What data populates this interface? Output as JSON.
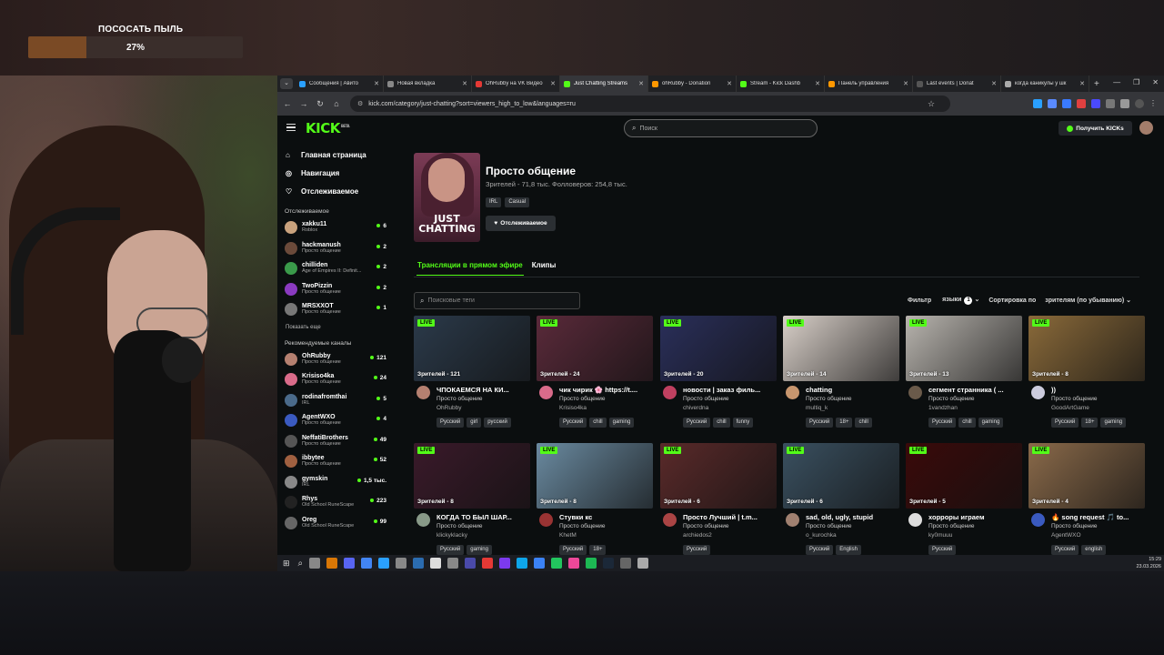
{
  "overlay": {
    "goal_title": "ПОСОСАТЬ ПЫЛЬ",
    "goal_percent": "27%",
    "goal_progress": 0.27
  },
  "browser": {
    "tabs": [
      {
        "label": "Сообщения | Авито",
        "color": "#2aa0ff"
      },
      {
        "label": "Новая вкладка",
        "color": "#888888"
      },
      {
        "label": "OhRubby на VK Видео",
        "color": "#e53935"
      },
      {
        "label": "Just Chatting Streams",
        "color": "#53fc18",
        "active": true
      },
      {
        "label": "ohRubby - Donation",
        "color": "#ff9800"
      },
      {
        "label": "Stream - Kick Dashb",
        "color": "#53fc18"
      },
      {
        "label": "Панель управления",
        "color": "#ff9800"
      },
      {
        "label": "Last events | Donat",
        "color": "#555555"
      },
      {
        "label": "когда каникулы у шк",
        "color": "#aaaaaa"
      }
    ],
    "url": "kick.com/category/just-chatting?sort=viewers_high_to_low&languages=ru"
  },
  "kick": {
    "logo": "KICK",
    "logo_sup": "BETA",
    "search_placeholder": "Поиск",
    "get_kicks": "Получить KICKs",
    "nav": [
      {
        "label": "Главная страница",
        "icon": "home-icon",
        "glyph": "⌂"
      },
      {
        "label": "Навигация",
        "icon": "compass-icon",
        "glyph": "◎"
      },
      {
        "label": "Отслеживаемое",
        "icon": "heart-icon",
        "glyph": "♡"
      }
    ],
    "following_title": "Отслеживаемое",
    "following": [
      {
        "name": "xakku11",
        "category": "Roblox",
        "count": "6",
        "color": "#c9a27d"
      },
      {
        "name": "hackmanush",
        "category": "Просто общение",
        "count": "2",
        "color": "#6b4a3a"
      },
      {
        "name": "chilliden",
        "category": "Age of Empires II: Definit...",
        "count": "2",
        "color": "#3a9a4a"
      },
      {
        "name": "TwoPizzin",
        "category": "Просто общение",
        "count": "2",
        "color": "#8a3ac0"
      },
      {
        "name": "MRSXXOT",
        "category": "Просто общение",
        "count": "1",
        "color": "#777777"
      }
    ],
    "show_more": "Показать еще",
    "recommended_title": "Рекомендуемые каналы",
    "recommended": [
      {
        "name": "OhRubby",
        "category": "Просто общение",
        "count": "121",
        "color": "#b58070"
      },
      {
        "name": "Krisiso4ka",
        "category": "Просто общение",
        "count": "24",
        "color": "#d96b8a"
      },
      {
        "name": "rodinafromthai",
        "category": "IRL",
        "count": "5",
        "color": "#4a6a8a"
      },
      {
        "name": "AgentWXO",
        "category": "Просто общение",
        "count": "4",
        "color": "#3a5ac0"
      },
      {
        "name": "NeffatiBrothers",
        "category": "Просто общение",
        "count": "49",
        "color": "#555555"
      },
      {
        "name": "ibbytee",
        "category": "Просто общение",
        "count": "52",
        "color": "#a06040"
      },
      {
        "name": "gymskin",
        "category": "IRL",
        "count": "1,5 тыс.",
        "color": "#888888"
      },
      {
        "name": "Rhys",
        "category": "Old School RuneScape",
        "count": "223",
        "color": "#222222"
      },
      {
        "name": "Oreg",
        "category": "Old School RuneScape",
        "count": "99",
        "color": "#666666"
      }
    ],
    "category": {
      "title": "Просто общение",
      "meta": "Зрителей - 71,8 тыс.  Фолловеров: 254,8 тыс.",
      "tags": [
        "IRL",
        "Casual"
      ],
      "follow_label": "Отслеживаемое",
      "image_text": "JUST CHATTING"
    },
    "tabs": [
      {
        "label": "Трансляции в прямом эфире",
        "active": true
      },
      {
        "label": "Клипы"
      }
    ],
    "tag_search_placeholder": "Поисковые теги",
    "filter": {
      "label": "Фильтр",
      "languages": "языки",
      "lang_count": "1",
      "sort_label": "Сортировка по",
      "sort_value": "зрителям (по убыванию)"
    },
    "live_label": "LIVE",
    "streams": [
      {
        "viewers": "Зрителей - 121",
        "title": "ЧПОКАЕМСЯ НА КИ...",
        "category": "Просто общение",
        "name": "OhRubby",
        "tags": [
          "Русский",
          "girl",
          "русский"
        ],
        "thumb": "#2b3a4a",
        "avatar": "#b58070"
      },
      {
        "viewers": "Зрителей - 24",
        "title": "чик чирик 🌸 https://t....",
        "category": "Просто общение",
        "name": "Krisiso4ka",
        "tags": [
          "Русский",
          "chill",
          "gaming"
        ],
        "thumb": "#5a2a3a",
        "avatar": "#d96b8a"
      },
      {
        "viewers": "Зрителей - 20",
        "title": "новости | заказ филь...",
        "category": "Просто общение",
        "name": "chiverdna",
        "tags": [
          "Русский",
          "chill",
          "funny"
        ],
        "thumb": "#2a2f5a",
        "avatar": "#c04060"
      },
      {
        "viewers": "Зрителей - 14",
        "title": "chatting",
        "category": "Просто общение",
        "name": "multiq_k",
        "tags": [
          "Русский",
          "18+",
          "chill"
        ],
        "thumb": "#d8cfc8",
        "avatar": "#c8966e"
      },
      {
        "viewers": "Зрителей - 13",
        "title": "сегмент странника ( ...",
        "category": "Просто общение",
        "name": "1vandzhan",
        "tags": [
          "Русский",
          "chill",
          "gaming"
        ],
        "thumb": "#b8b4ae",
        "avatar": "#6a5a4a"
      },
      {
        "viewers": "Зрителей - 8",
        "title": "))",
        "category": "Просто общение",
        "name": "GoodArtGame",
        "tags": [
          "Русский",
          "18+",
          "gaming"
        ],
        "thumb": "#8a6a3a",
        "avatar": "#ccccdd"
      },
      {
        "viewers": "Зрителей - 8",
        "title": "КОГДА ТО БЫЛ ШАР...",
        "category": "Просто общение",
        "name": "klickyklacky",
        "tags": [
          "Русский",
          "gaming"
        ],
        "thumb": "#3a1a2a",
        "avatar": "#889988"
      },
      {
        "viewers": "Зрителей - 8",
        "title": "Стувки кс",
        "category": "Просто общение",
        "name": "KhetM",
        "tags": [
          "Русский",
          "18+"
        ],
        "thumb": "#6a8aa0",
        "avatar": "#993333"
      },
      {
        "viewers": "Зрителей - 6",
        "title": "Просто Лучший | t.m...",
        "category": "Просто общение",
        "name": "archiedos2",
        "tags": [
          "Русский"
        ],
        "thumb": "#5a2a2a",
        "avatar": "#aa4444"
      },
      {
        "viewers": "Зрителей - 6",
        "title": "sad, old, ugly, stupid",
        "category": "Просто общение",
        "name": "o_kurochka",
        "tags": [
          "Русский",
          "English"
        ],
        "thumb": "#3a5060",
        "avatar": "#a08070"
      },
      {
        "viewers": "Зрителей - 5",
        "title": "хорроры играем",
        "category": "Просто общение",
        "name": "ky0muuu",
        "tags": [
          "Русский"
        ],
        "thumb": "#3a0a0a",
        "avatar": "#dddddd"
      },
      {
        "viewers": "Зрителей - 4",
        "title": "🔥 song request 🎵 to...",
        "category": "Просто общение",
        "name": "AgentWXO",
        "tags": [
          "Русский",
          "english"
        ],
        "thumb": "#8a6a4a",
        "avatar": "#3a5ac0"
      }
    ]
  },
  "taskbar": {
    "time": "15:29",
    "date": "23.03.2026"
  }
}
